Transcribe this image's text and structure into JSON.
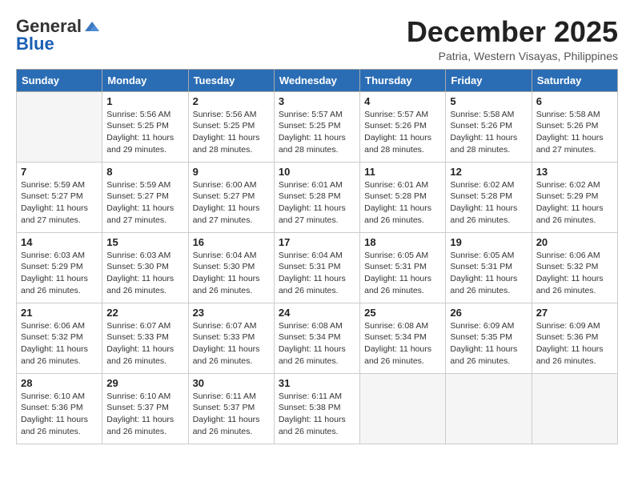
{
  "header": {
    "logo_general": "General",
    "logo_blue": "Blue",
    "month_title": "December 2025",
    "location": "Patria, Western Visayas, Philippines"
  },
  "days_of_week": [
    "Sunday",
    "Monday",
    "Tuesday",
    "Wednesday",
    "Thursday",
    "Friday",
    "Saturday"
  ],
  "weeks": [
    [
      {
        "day": "",
        "info": ""
      },
      {
        "day": "1",
        "info": "Sunrise: 5:56 AM\nSunset: 5:25 PM\nDaylight: 11 hours\nand 29 minutes."
      },
      {
        "day": "2",
        "info": "Sunrise: 5:56 AM\nSunset: 5:25 PM\nDaylight: 11 hours\nand 28 minutes."
      },
      {
        "day": "3",
        "info": "Sunrise: 5:57 AM\nSunset: 5:25 PM\nDaylight: 11 hours\nand 28 minutes."
      },
      {
        "day": "4",
        "info": "Sunrise: 5:57 AM\nSunset: 5:26 PM\nDaylight: 11 hours\nand 28 minutes."
      },
      {
        "day": "5",
        "info": "Sunrise: 5:58 AM\nSunset: 5:26 PM\nDaylight: 11 hours\nand 28 minutes."
      },
      {
        "day": "6",
        "info": "Sunrise: 5:58 AM\nSunset: 5:26 PM\nDaylight: 11 hours\nand 27 minutes."
      }
    ],
    [
      {
        "day": "7",
        "info": "Sunrise: 5:59 AM\nSunset: 5:27 PM\nDaylight: 11 hours\nand 27 minutes."
      },
      {
        "day": "8",
        "info": "Sunrise: 5:59 AM\nSunset: 5:27 PM\nDaylight: 11 hours\nand 27 minutes."
      },
      {
        "day": "9",
        "info": "Sunrise: 6:00 AM\nSunset: 5:27 PM\nDaylight: 11 hours\nand 27 minutes."
      },
      {
        "day": "10",
        "info": "Sunrise: 6:01 AM\nSunset: 5:28 PM\nDaylight: 11 hours\nand 27 minutes."
      },
      {
        "day": "11",
        "info": "Sunrise: 6:01 AM\nSunset: 5:28 PM\nDaylight: 11 hours\nand 26 minutes."
      },
      {
        "day": "12",
        "info": "Sunrise: 6:02 AM\nSunset: 5:28 PM\nDaylight: 11 hours\nand 26 minutes."
      },
      {
        "day": "13",
        "info": "Sunrise: 6:02 AM\nSunset: 5:29 PM\nDaylight: 11 hours\nand 26 minutes."
      }
    ],
    [
      {
        "day": "14",
        "info": "Sunrise: 6:03 AM\nSunset: 5:29 PM\nDaylight: 11 hours\nand 26 minutes."
      },
      {
        "day": "15",
        "info": "Sunrise: 6:03 AM\nSunset: 5:30 PM\nDaylight: 11 hours\nand 26 minutes."
      },
      {
        "day": "16",
        "info": "Sunrise: 6:04 AM\nSunset: 5:30 PM\nDaylight: 11 hours\nand 26 minutes."
      },
      {
        "day": "17",
        "info": "Sunrise: 6:04 AM\nSunset: 5:31 PM\nDaylight: 11 hours\nand 26 minutes."
      },
      {
        "day": "18",
        "info": "Sunrise: 6:05 AM\nSunset: 5:31 PM\nDaylight: 11 hours\nand 26 minutes."
      },
      {
        "day": "19",
        "info": "Sunrise: 6:05 AM\nSunset: 5:31 PM\nDaylight: 11 hours\nand 26 minutes."
      },
      {
        "day": "20",
        "info": "Sunrise: 6:06 AM\nSunset: 5:32 PM\nDaylight: 11 hours\nand 26 minutes."
      }
    ],
    [
      {
        "day": "21",
        "info": "Sunrise: 6:06 AM\nSunset: 5:32 PM\nDaylight: 11 hours\nand 26 minutes."
      },
      {
        "day": "22",
        "info": "Sunrise: 6:07 AM\nSunset: 5:33 PM\nDaylight: 11 hours\nand 26 minutes."
      },
      {
        "day": "23",
        "info": "Sunrise: 6:07 AM\nSunset: 5:33 PM\nDaylight: 11 hours\nand 26 minutes."
      },
      {
        "day": "24",
        "info": "Sunrise: 6:08 AM\nSunset: 5:34 PM\nDaylight: 11 hours\nand 26 minutes."
      },
      {
        "day": "25",
        "info": "Sunrise: 6:08 AM\nSunset: 5:34 PM\nDaylight: 11 hours\nand 26 minutes."
      },
      {
        "day": "26",
        "info": "Sunrise: 6:09 AM\nSunset: 5:35 PM\nDaylight: 11 hours\nand 26 minutes."
      },
      {
        "day": "27",
        "info": "Sunrise: 6:09 AM\nSunset: 5:36 PM\nDaylight: 11 hours\nand 26 minutes."
      }
    ],
    [
      {
        "day": "28",
        "info": "Sunrise: 6:10 AM\nSunset: 5:36 PM\nDaylight: 11 hours\nand 26 minutes."
      },
      {
        "day": "29",
        "info": "Sunrise: 6:10 AM\nSunset: 5:37 PM\nDaylight: 11 hours\nand 26 minutes."
      },
      {
        "day": "30",
        "info": "Sunrise: 6:11 AM\nSunset: 5:37 PM\nDaylight: 11 hours\nand 26 minutes."
      },
      {
        "day": "31",
        "info": "Sunrise: 6:11 AM\nSunset: 5:38 PM\nDaylight: 11 hours\nand 26 minutes."
      },
      {
        "day": "",
        "info": ""
      },
      {
        "day": "",
        "info": ""
      },
      {
        "day": "",
        "info": ""
      }
    ]
  ]
}
